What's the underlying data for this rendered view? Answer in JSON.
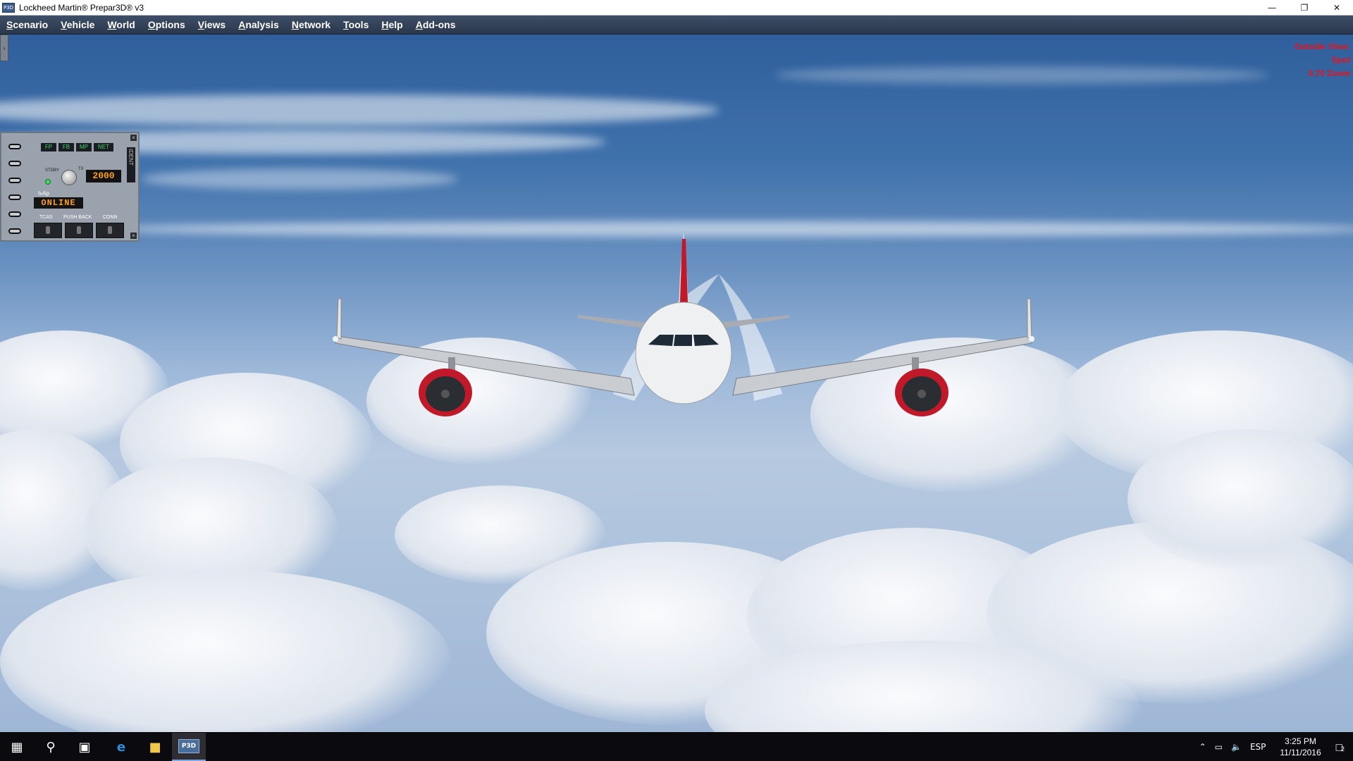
{
  "window": {
    "title": "Lockheed Martin® Prepar3D® v3",
    "icon_label": "P3D",
    "controls": [
      "minimize-icon",
      "restore-icon",
      "close-icon"
    ]
  },
  "menu": [
    "Scenario",
    "Vehicle",
    "World",
    "Options",
    "Views",
    "Analysis",
    "Network",
    "Tools",
    "Help",
    "Add-ons"
  ],
  "hud": {
    "line1": "Outside View:",
    "line2": "Spot",
    "line3": "0.70 Zoom",
    "color": "#e8121e"
  },
  "panel": {
    "tabs": [
      "FP",
      "FB",
      "MP",
      "NET"
    ],
    "stdby_label": "STDBY",
    "tx_label": "TX",
    "transponder_code": "2000",
    "ident_label": "IDENT",
    "ivap_label": "IvAp",
    "status": "ONLINE",
    "buttons": [
      "TCAS",
      "PUSH BACK",
      "CONN"
    ],
    "close_glyph": "×"
  },
  "taskbar": {
    "app_label": "P3D",
    "language": "ESP",
    "time": "3:25 PM",
    "date": "11/11/2016",
    "notification_count": "2"
  }
}
